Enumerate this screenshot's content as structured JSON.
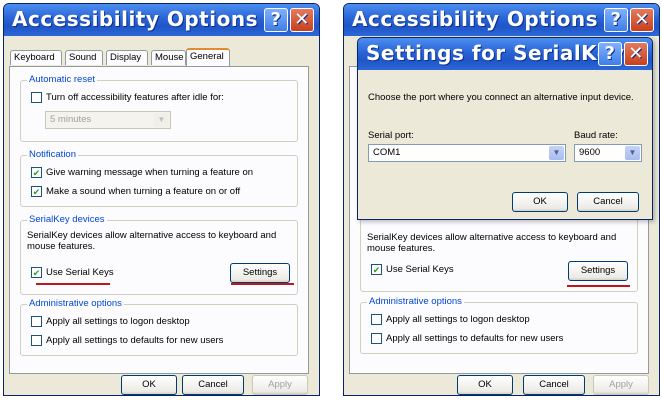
{
  "left_window": {
    "title": "Accessibility Options",
    "tabs": [
      "Keyboard",
      "Sound",
      "Display",
      "Mouse",
      "General"
    ],
    "automatic_reset": {
      "title": "Automatic reset",
      "turn_off_label": "Turn off accessibility features after idle for:",
      "idle_value": "5 minutes"
    },
    "notification": {
      "title": "Notification",
      "warning_label": "Give warning message when turning a feature on",
      "sound_label": "Make a sound when turning a feature on or off"
    },
    "serialkey": {
      "title": "SerialKey devices",
      "description": "SerialKey devices allow alternative access to keyboard and mouse features.",
      "use_label": "Use Serial Keys",
      "settings_label": "Settings"
    },
    "admin": {
      "title": "Administrative options",
      "logon_label": "Apply all settings to logon desktop",
      "defaults_label": "Apply all settings to defaults for new users"
    },
    "buttons": {
      "ok": "OK",
      "cancel": "Cancel",
      "apply": "Apply"
    }
  },
  "right_window": {
    "title": "Accessibility Options",
    "serialkey": {
      "description": "SerialKey devices allow alternative access to keyboard and mouse features.",
      "use_label": "Use Serial Keys",
      "settings_label": "Settings"
    },
    "admin": {
      "title": "Administrative options",
      "logon_label": "Apply all settings to logon desktop",
      "defaults_label": "Apply all settings to defaults for new users"
    },
    "buttons": {
      "ok": "OK",
      "cancel": "Cancel",
      "apply": "Apply"
    }
  },
  "serialkeys_dialog": {
    "title": "Settings for SerialKeys",
    "instruction": "Choose the port where you connect an alternative input device.",
    "serial_port_label": "Serial port:",
    "serial_port_value": "COM1",
    "baud_rate_label": "Baud rate:",
    "baud_rate_value": "9600",
    "ok": "OK",
    "cancel": "Cancel"
  },
  "icons": {
    "help": "?",
    "close": "✕",
    "check": "✔",
    "dropdown": "▼"
  },
  "colors": {
    "accent_underline": "#c0151b",
    "group_title": "#0046d5",
    "titlebar": "#2a63d6"
  }
}
